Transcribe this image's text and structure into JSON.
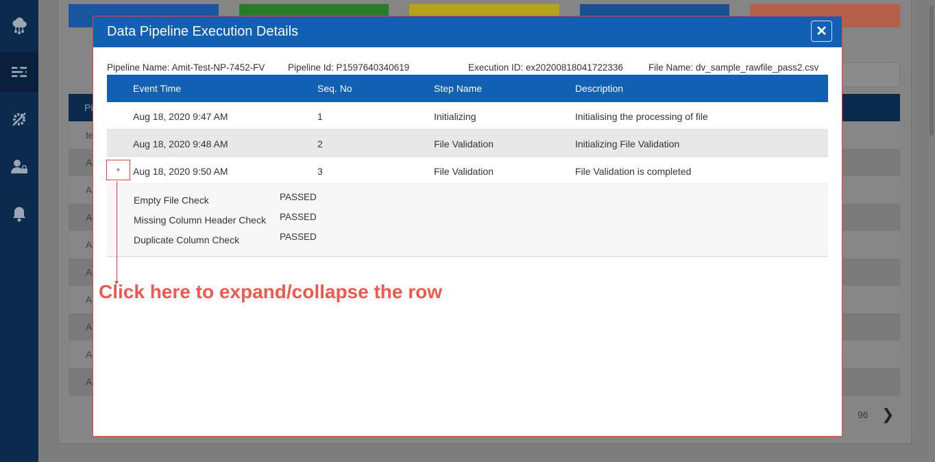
{
  "background": {
    "sidebar": {
      "items": [
        {
          "name": "cloud-network-icon",
          "active": false
        },
        {
          "name": "pipeline-icon",
          "active": true
        },
        {
          "name": "settings-tools-icon",
          "active": false
        },
        {
          "name": "user-lock-icon",
          "active": false
        },
        {
          "name": "bell-icon",
          "active": false
        }
      ]
    },
    "tile_colors": [
      "#1a55a0",
      "#2a7a2c",
      "#b6a21c",
      "#1b4f92",
      "#b45f4a"
    ],
    "table": {
      "header_fragment": "Pi",
      "row_fragments": [
        "te",
        "A",
        "A",
        "A",
        "A",
        "A",
        "A",
        "A",
        "A",
        "A"
      ]
    },
    "pagination": {
      "page_text": "96",
      "next_glyph": "❯"
    }
  },
  "modal": {
    "title": "Data Pipeline Execution Details",
    "close_glyph": "✕",
    "meta": {
      "pipeline_name": "Pipeline Name: Amit-Test-NP-7452-FV",
      "pipeline_id": "Pipeline Id: P1597640340619",
      "execution_id": "Execution ID: ex20200818041722336",
      "file_name": "File Name: dv_sample_rawfile_pass2.csv"
    },
    "table": {
      "columns": [
        "Event Time",
        "Seq. No",
        "Step Name",
        "Description"
      ],
      "rows": [
        {
          "event_time": "Aug 18, 2020 9:47 AM",
          "seq_no": "1",
          "step_name": "Initializing",
          "description": "Initialising the processing of file"
        },
        {
          "event_time": "Aug 18, 2020 9:48 AM",
          "seq_no": "2",
          "step_name": "File Validation",
          "description": "Initializing File Validation"
        },
        {
          "event_time": "Aug 18, 2020 9:50 AM",
          "seq_no": "3",
          "step_name": "File Validation",
          "description": "File Validation is completed",
          "expand_glyph": "▼"
        }
      ],
      "details": [
        {
          "check": "Empty File Check",
          "status": "PASSED"
        },
        {
          "check": "Missing Column Header Check",
          "status": "PASSED"
        },
        {
          "check": "Duplicate Column Check",
          "status": "PASSED"
        }
      ]
    }
  },
  "annotation": {
    "text": "Click here to expand/collapse the row",
    "color": "#f0584f"
  },
  "colors": {
    "header_blue": "#1160b4",
    "annotation_red": "#e0463e",
    "sidebar_navy": "#0c2a4c"
  }
}
